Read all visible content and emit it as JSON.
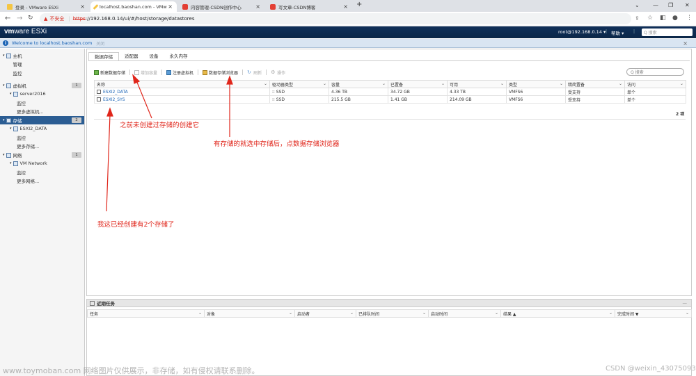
{
  "browser": {
    "tabs": [
      {
        "title": "登录 - VMware ESXi",
        "active": false
      },
      {
        "title": "localhost.baoshan.com - VMw",
        "active": true
      },
      {
        "title": "内容管理-CSDN创作中心",
        "active": false
      },
      {
        "title": "写文章-CSDN博客",
        "active": false
      }
    ],
    "new_tab": "+",
    "insecure_label": "不安全",
    "url_scheme": "https",
    "url_rest": "://192.168.0.14/ui/#/host/storage/datastores"
  },
  "esxi": {
    "brand_vm": "vm",
    "brand_ware": "ware",
    "brand_product": "ESXi",
    "user_menu": "root@192.168.0.14 ▾",
    "help_menu": "帮助 ▾",
    "search_placeholder": "Q 搜索",
    "welcome_text": "Welcome to localhost.baoshan.com",
    "welcome_tail": "关闭"
  },
  "navigator": {
    "items": [
      {
        "label": "主机",
        "level": 0,
        "badge": "",
        "selected": false
      },
      {
        "label": "管理",
        "level": 1,
        "badge": "",
        "selected": false
      },
      {
        "label": "监控",
        "level": 1,
        "badge": "",
        "selected": false
      },
      {
        "label": "虚拟机",
        "level": 0,
        "badge": "1",
        "selected": false
      },
      {
        "label": "server2016",
        "level": 1,
        "badge": "",
        "selected": false
      },
      {
        "label": "监控",
        "level": 2,
        "badge": "",
        "selected": false
      },
      {
        "label": "更多虚拟机...",
        "level": 2,
        "badge": "",
        "selected": false
      },
      {
        "label": "存储",
        "level": 0,
        "badge": "2",
        "selected": true
      },
      {
        "label": "ESXI2_DATA",
        "level": 1,
        "badge": "",
        "selected": false
      },
      {
        "label": "监控",
        "level": 2,
        "badge": "",
        "selected": false
      },
      {
        "label": "更多存储...",
        "level": 2,
        "badge": "",
        "selected": false
      },
      {
        "label": "网络",
        "level": 0,
        "badge": "1",
        "selected": false
      },
      {
        "label": "VM Network",
        "level": 1,
        "badge": "",
        "selected": false
      },
      {
        "label": "监控",
        "level": 2,
        "badge": "",
        "selected": false
      },
      {
        "label": "更多网络...",
        "level": 2,
        "badge": "",
        "selected": false
      }
    ]
  },
  "content": {
    "tabs": [
      "数据存储",
      "适配器",
      "设备",
      "永久内存"
    ],
    "toolbar": {
      "new_datastore": "新建数据存储",
      "increase_capacity": "增加容量",
      "register_vm": "注册虚拟机",
      "datastore_browser": "数据存储浏览器",
      "refresh": "刷新",
      "actions": "操作"
    },
    "search_placeholder": "Q 搜索",
    "columns": [
      "名称",
      "驱动器类型",
      "容量",
      "已置备",
      "可用",
      "类型",
      "精简置备",
      "访问"
    ],
    "rows": [
      [
        "ESXI2_DATA",
        "SSD",
        "4.36 TB",
        "34.72 GB",
        "4.33 TB",
        "VMFS6",
        "受支持",
        "单个"
      ],
      [
        "ESXI2_SYS",
        "SSD",
        "215.5 GB",
        "1.41 GB",
        "214.09 GB",
        "VMFS6",
        "受支持",
        "单个"
      ]
    ],
    "count": "2 项"
  },
  "recent_tasks": {
    "title": "近期任务",
    "columns": [
      "任务",
      "对象",
      "启动者",
      "已排队时间",
      "启动时间",
      "结果 ▲",
      "完成时间 ▼"
    ]
  },
  "annotations": {
    "note_new": "之前未创建过存储的创建它",
    "note_browser": "有存储的就选中存储后，点数据存储浏览器",
    "note_existing": "我这已经创建有2个存储了",
    "color": "#e0261b"
  },
  "watermark": {
    "left": "www.toymoban.com 网络图片仅供展示，非存储，如有侵权请联系删除。",
    "right": "CSDN @weixin_43075093"
  }
}
